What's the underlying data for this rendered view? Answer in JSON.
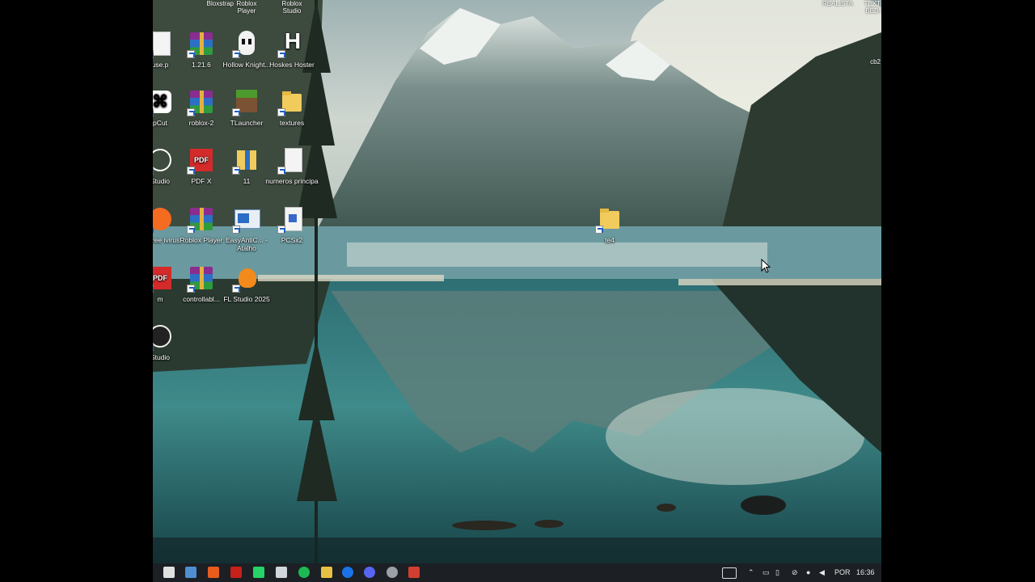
{
  "desktop": {
    "top_labels": [
      {
        "text": "Bloxstrap"
      },
      {
        "text": "Roblox Player"
      },
      {
        "text": "Roblox Studio"
      }
    ],
    "icons": [
      {
        "label": "use.p",
        "kind": "doc"
      },
      {
        "label": "1.21.6",
        "kind": "rar"
      },
      {
        "label": "Hollow Knight...",
        "kind": "hollow"
      },
      {
        "label": "Hoskes Hoster",
        "kind": "h"
      },
      {
        "label": "pCut",
        "kind": "capcut"
      },
      {
        "label": "roblox-2",
        "kind": "rar"
      },
      {
        "label": "TLauncher",
        "kind": "mc"
      },
      {
        "label": "textures",
        "kind": "folder"
      },
      {
        "label": "Studio",
        "kind": "studio"
      },
      {
        "label": "PDF X",
        "kind": "pdf"
      },
      {
        "label": "11",
        "kind": "folderblue"
      },
      {
        "label": "numeros principa",
        "kind": "doc"
      },
      {
        "label": "st Free ivirus",
        "kind": "avast"
      },
      {
        "label": "Roblox Player",
        "kind": "rar"
      },
      {
        "label": "EasyAntiC... - Atalho",
        "kind": "window"
      },
      {
        "label": "PCSx2",
        "kind": "pcsx"
      },
      {
        "label": "m",
        "kind": "pdf"
      },
      {
        "label": "controllabl...",
        "kind": "rar"
      },
      {
        "label": "FL Studio 2025",
        "kind": "fl"
      },
      {
        "label": "Studio",
        "kind": "obs"
      },
      {
        "label": "te4",
        "kind": "folder"
      }
    ],
    "right_labels": {
      "a": "REALISTA",
      "b": "TEXT BED\\",
      "c": "cb2"
    }
  },
  "taskbar": {
    "language": "POR",
    "time": "16:36",
    "icon_colors": [
      "#e0e0e0",
      "#4f8fd0",
      "#e85c1e",
      "#c8201a",
      "#25d366",
      "#d0d6dc",
      "#1db954",
      "#e8c043",
      "#1a73e8",
      "#5865f2",
      "#9aa0a6",
      "#d23f31"
    ]
  }
}
